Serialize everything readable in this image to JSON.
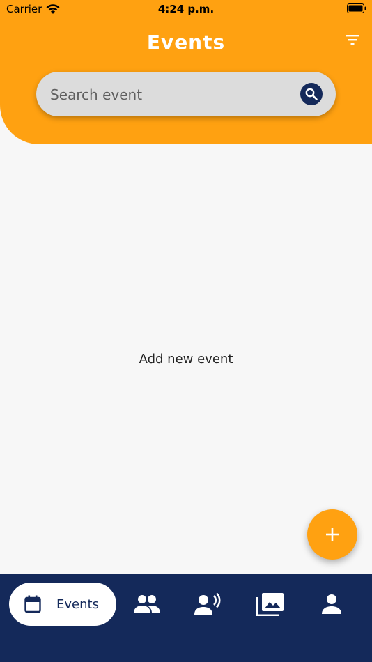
{
  "status_bar": {
    "carrier": "Carrier",
    "time": "4:24 p.m."
  },
  "header": {
    "title": "Events",
    "filter_icon": "filter-icon"
  },
  "search": {
    "placeholder": "Search event",
    "value": "",
    "icon": "search-icon"
  },
  "main": {
    "empty_message": "Add new event"
  },
  "fab": {
    "icon": "plus-icon"
  },
  "bottom_nav": {
    "items": [
      {
        "label": "Events",
        "icon": "calendar-icon",
        "active": true
      },
      {
        "label": "",
        "icon": "group-icon",
        "active": false
      },
      {
        "label": "",
        "icon": "speaker-person-icon",
        "active": false
      },
      {
        "label": "",
        "icon": "photo-library-icon",
        "active": false
      },
      {
        "label": "",
        "icon": "person-icon",
        "active": false
      }
    ]
  },
  "colors": {
    "accent": "#ffa111",
    "navy": "#14295a",
    "background": "#f7f7f7"
  }
}
